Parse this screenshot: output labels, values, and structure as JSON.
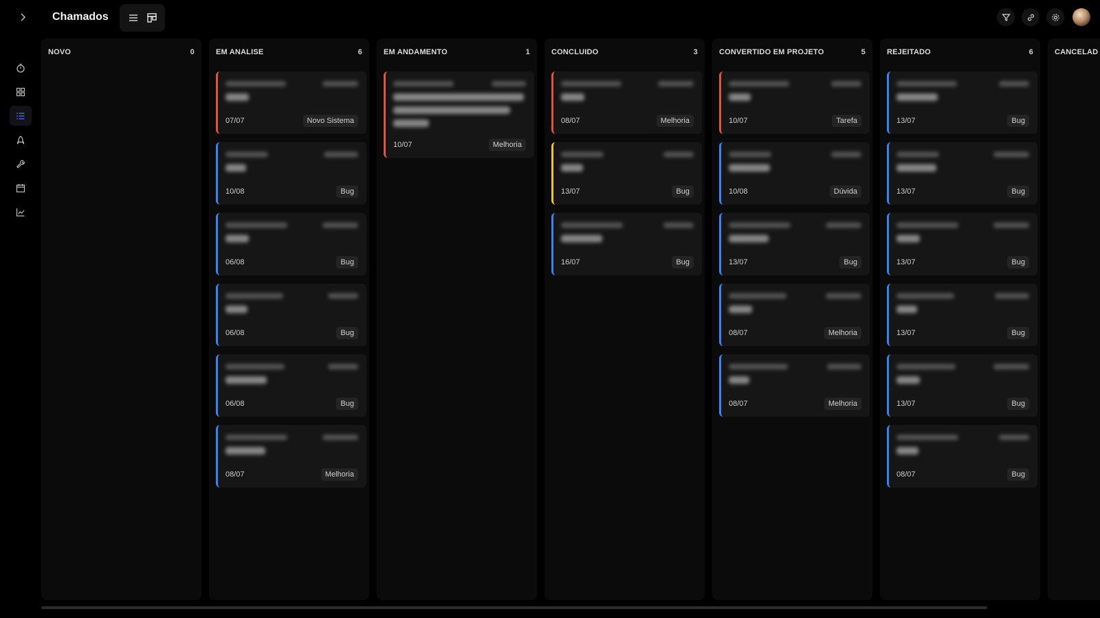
{
  "header": {
    "title": "Chamados",
    "icons": [
      "chevron-right-icon",
      "list-view-icon",
      "kanban-view-icon",
      "filter-icon",
      "link-icon",
      "settings-icon",
      "avatar"
    ]
  },
  "sidebar": {
    "items": [
      {
        "icon": "timer-icon",
        "active": false
      },
      {
        "icon": "grid-icon",
        "active": false
      },
      {
        "icon": "list-icon",
        "active": true
      },
      {
        "icon": "rocket-icon",
        "active": false
      },
      {
        "icon": "wrench-icon",
        "active": false
      },
      {
        "icon": "calendar-icon",
        "active": false
      },
      {
        "icon": "chart-line-icon",
        "active": false
      }
    ],
    "active_color": "#5b6bff"
  },
  "colors": {
    "red": "#e5533d",
    "blue": "#3b82f6",
    "yellow": "#f5c518"
  },
  "columns": [
    {
      "title": "NOVO",
      "count": "0",
      "cards": []
    },
    {
      "title": "EM ANALISE",
      "count": "6",
      "cards": [
        {
          "date": "07/07",
          "tag": "Novo Sistema",
          "color": "red"
        },
        {
          "date": "10/08",
          "tag": "Bug",
          "color": "blue"
        },
        {
          "date": "06/08",
          "tag": "Bug",
          "color": "blue"
        },
        {
          "date": "06/08",
          "tag": "Bug",
          "color": "blue"
        },
        {
          "date": "06/08",
          "tag": "Bug",
          "color": "blue"
        },
        {
          "date": "08/07",
          "tag": "Melhoria",
          "color": "blue"
        }
      ]
    },
    {
      "title": "EM ANDAMENTO",
      "count": "1",
      "cards": [
        {
          "date": "10/07",
          "tag": "Melhoria",
          "color": "red",
          "tall": true
        }
      ]
    },
    {
      "title": "CONCLUIDO",
      "count": "3",
      "cards": [
        {
          "date": "08/07",
          "tag": "Melhoria",
          "color": "red"
        },
        {
          "date": "13/07",
          "tag": "Bug",
          "color": "yellow"
        },
        {
          "date": "16/07",
          "tag": "Bug",
          "color": "blue"
        }
      ]
    },
    {
      "title": "CONVERTIDO EM PROJETO",
      "count": "5",
      "cards": [
        {
          "date": "10/07",
          "tag": "Tarefa",
          "color": "red"
        },
        {
          "date": "10/08",
          "tag": "Dúvida",
          "color": "blue"
        },
        {
          "date": "13/07",
          "tag": "Bug",
          "color": "blue"
        },
        {
          "date": "08/07",
          "tag": "Melhoria",
          "color": "blue"
        },
        {
          "date": "08/07",
          "tag": "Melhoria",
          "color": "blue"
        }
      ]
    },
    {
      "title": "REJEITADO",
      "count": "6",
      "cards": [
        {
          "date": "13/07",
          "tag": "Bug",
          "color": "blue"
        },
        {
          "date": "13/07",
          "tag": "Bug",
          "color": "blue"
        },
        {
          "date": "13/07",
          "tag": "Bug",
          "color": "blue"
        },
        {
          "date": "13/07",
          "tag": "Bug",
          "color": "blue"
        },
        {
          "date": "13/07",
          "tag": "Bug",
          "color": "blue"
        },
        {
          "date": "08/07",
          "tag": "Bug",
          "color": "blue"
        }
      ]
    },
    {
      "title": "CANCELAD",
      "count": "",
      "cards": []
    }
  ]
}
